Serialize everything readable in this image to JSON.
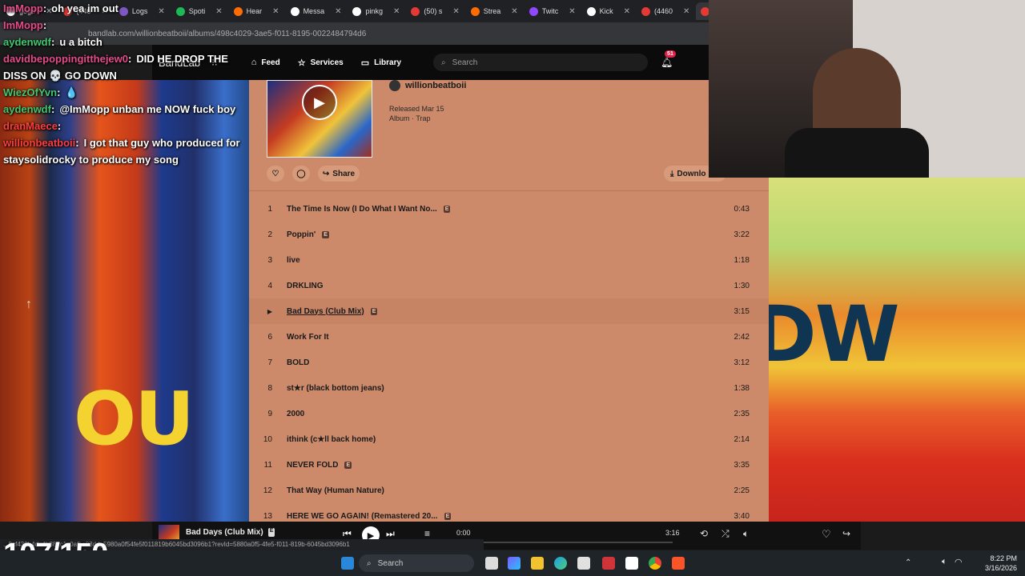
{
  "browser": {
    "tabs": [
      {
        "label": "gogo",
        "color": "#ffffff",
        "active": false
      },
      {
        "label": "(446",
        "color": "#e53935",
        "active": false
      },
      {
        "label": "Logs",
        "color": "#7e57c2",
        "active": false
      },
      {
        "label": "Spoti",
        "color": "#1db954",
        "active": false
      },
      {
        "label": "Hear",
        "color": "#ff6d00",
        "active": false
      },
      {
        "label": "Messa",
        "color": "#ffffff",
        "active": false
      },
      {
        "label": "pinkg",
        "color": "#ffffff",
        "active": false
      },
      {
        "label": "(50) s",
        "color": "#e53935",
        "active": false
      },
      {
        "label": "Strea",
        "color": "#ff6d00",
        "active": false
      },
      {
        "label": "Twitc",
        "color": "#9146ff",
        "active": false
      },
      {
        "label": "Kick",
        "color": "#ffffff",
        "active": false
      },
      {
        "label": "(4460",
        "color": "#e53935",
        "active": false
      },
      {
        "label": "(50) M",
        "color": "#e53935",
        "active": true
      }
    ],
    "url": "bandlab.com/willionbeatboii/albums/498c4029-3ae5-f011-8195-0022484794d6"
  },
  "bandlab": {
    "logo": "BandLab",
    "nav": [
      {
        "label": "Feed",
        "icon": "home-icon"
      },
      {
        "label": "Services",
        "icon": "star-icon"
      },
      {
        "label": "Library",
        "icon": "library-icon"
      }
    ],
    "search_placeholder": "Search",
    "notification_count": "51"
  },
  "chat": [
    {
      "user": "ImMopp",
      "sep": ":",
      "msg": "oh yea im out",
      "color": "#e64a8b"
    },
    {
      "user": "ImMopp",
      "sep": ":",
      "msg": "",
      "color": "#e64a8b"
    },
    {
      "user": "aydenwdf",
      "sep": ":",
      "msg": "u a bitch",
      "color": "#41c76f"
    },
    {
      "user": "davidbepoppingitthejew0",
      "sep": ":",
      "msg": "DID HE DROP THE DISS ON 💀 GO DOWN",
      "color": "#e64a8b"
    },
    {
      "user": "WiezOfYvn",
      "sep": ":",
      "msg": "💧",
      "color": "#41c76f"
    },
    {
      "user": "aydenwdf",
      "sep": ":",
      "msg": "@ImMopp unban me NOW fuck boy",
      "color": "#41c76f"
    },
    {
      "user": "dranMaece",
      "sep": ":",
      "msg": "",
      "color": "#ff3d3d"
    },
    {
      "user": "willionbeatboii",
      "sep": ":",
      "msg": "I got that guy who produced for staysolidrocky to produce my song",
      "color": "#ff3d3d"
    }
  ],
  "album": {
    "artist": "willionbeatboii",
    "released": "Released Mar 15",
    "type": "Album · Trap",
    "share_label": "Share",
    "download_label": "Downlo",
    "tracks": [
      {
        "num": "1",
        "title": "The Time Is Now (I Do What I Want No...",
        "explicit": true,
        "duration": "0:43"
      },
      {
        "num": "2",
        "title": "Poppin'",
        "explicit": true,
        "duration": "3:22"
      },
      {
        "num": "3",
        "title": "live",
        "explicit": false,
        "duration": "1:18"
      },
      {
        "num": "4",
        "title": "DRKLING",
        "explicit": false,
        "duration": "1:30"
      },
      {
        "num": "5",
        "title": "Bad Days (Club Mix)",
        "explicit": true,
        "duration": "3:15",
        "hover": true
      },
      {
        "num": "6",
        "title": "Work For It",
        "explicit": false,
        "duration": "2:42"
      },
      {
        "num": "7",
        "title": "BOLD",
        "explicit": false,
        "duration": "3:12"
      },
      {
        "num": "8",
        "title": "st★r (black bottom jeans)",
        "explicit": false,
        "duration": "1:38"
      },
      {
        "num": "9",
        "title": "2000",
        "explicit": false,
        "duration": "2:35"
      },
      {
        "num": "10",
        "title": "ithink (c★ll back home)",
        "explicit": false,
        "duration": "2:14"
      },
      {
        "num": "11",
        "title": "NEVER FOLD",
        "explicit": true,
        "duration": "3:35"
      },
      {
        "num": "12",
        "title": "That Way (Human Nature)",
        "explicit": false,
        "duration": "2:25"
      },
      {
        "num": "13",
        "title": "HERE WE GO AGAIN! (Remastered 20...",
        "explicit": true,
        "duration": "3:40"
      }
    ],
    "explicit_badge": "E"
  },
  "player": {
    "track": "Bad Days (Club Mix)",
    "elapsed": "0:00",
    "total": "3:16"
  },
  "stream": {
    "counter": "107/150",
    "art_left_text": "OU",
    "art_right_text": "DW",
    "status_url": "...5cf439b4da4b881c1c0afbc93dd_5980a0f54fe5f011819b6045bd3096b1?revId=5880a0f5-4fe5-f011-819b-6045bd3096b1"
  },
  "taskbar": {
    "search_label": "Search",
    "time": "8:22 PM",
    "date": "3/16/2026"
  }
}
